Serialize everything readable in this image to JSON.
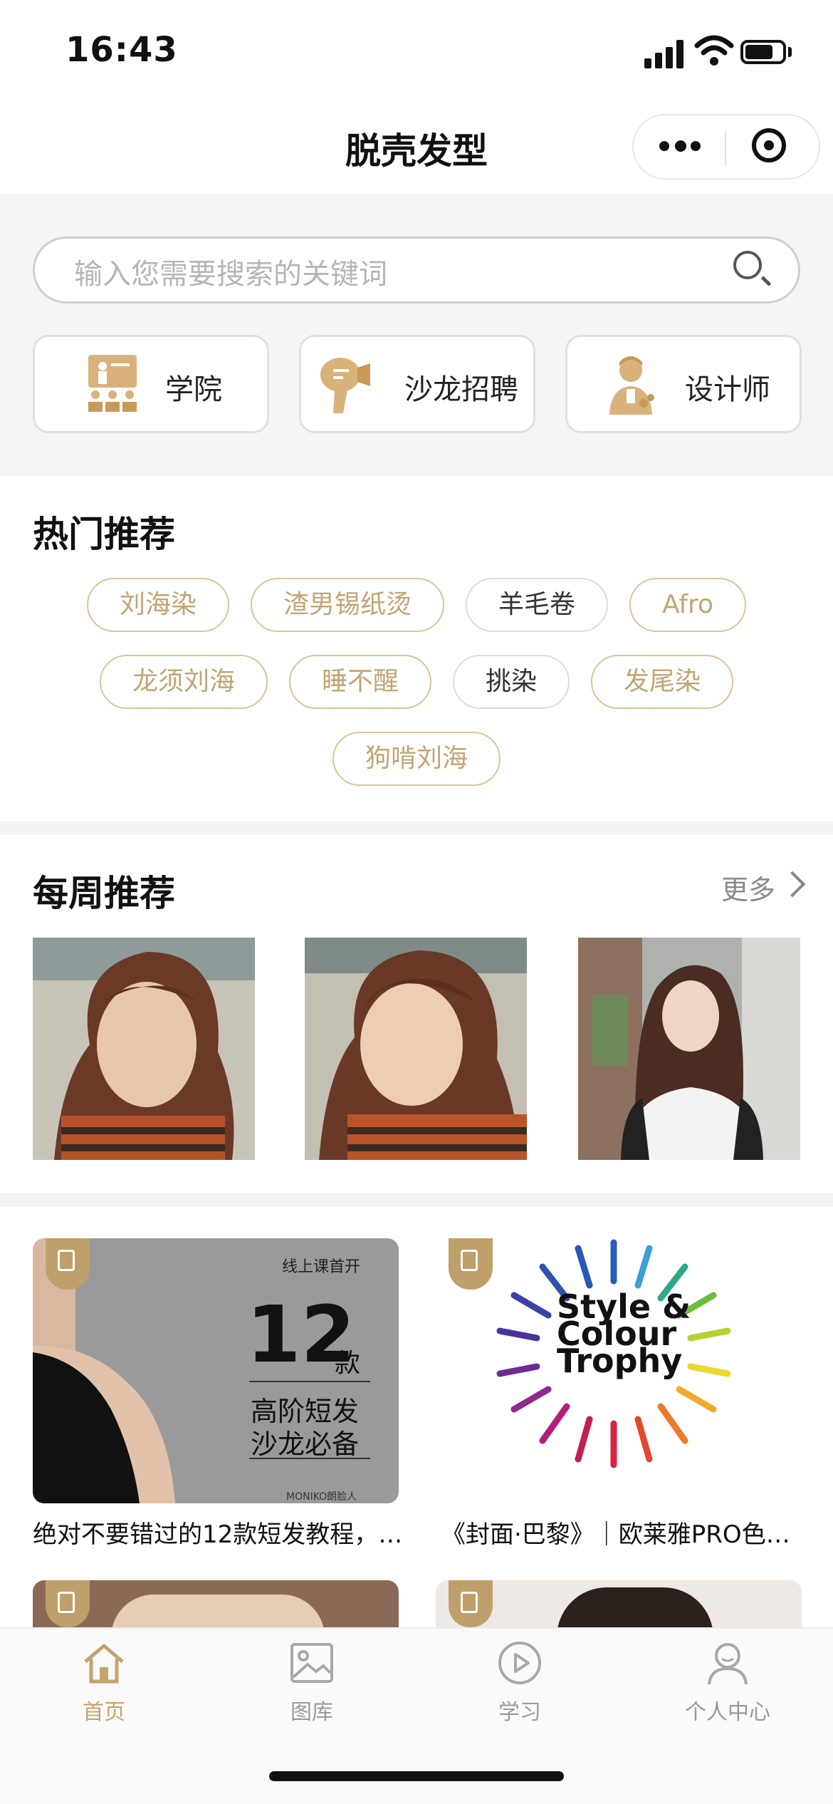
{
  "status_bar": {
    "time": "16:43"
  },
  "nav": {
    "title": "脱壳发型"
  },
  "search": {
    "placeholder": "输入您需要搜索的关键词"
  },
  "quick_links": [
    {
      "label": "学院",
      "icon": "academy-icon"
    },
    {
      "label": "沙龙招聘",
      "icon": "hair-dryer-icon"
    },
    {
      "label": "设计师",
      "icon": "designer-icon"
    }
  ],
  "hot": {
    "title": "热门推荐",
    "tags": [
      "刘海染",
      "渣男锡纸烫",
      "羊毛卷",
      "Afro",
      "龙须刘海",
      "睡不醒",
      "挑染",
      "发尾染",
      "狗啃刘海"
    ]
  },
  "weekly": {
    "title": "每周推荐",
    "more_label": "更多"
  },
  "feed": [
    {
      "title": "绝对不要错过的12款短发教程，…",
      "badge_icon": "document-icon",
      "cover": {
        "top_text": "线上课首开",
        "big_number": "12",
        "unit": "款",
        "line1": "高阶短发",
        "line2": "沙龙必备",
        "brand": "MONIKO朗脸人"
      }
    },
    {
      "title": "《封面·巴黎》｜欧莱雅PRO色…",
      "badge_icon": "document-icon",
      "cover": {
        "line1": "Style &",
        "line2": "Colour",
        "line3": "Trophy"
      }
    }
  ],
  "tabbar": {
    "items": [
      {
        "label": "首页",
        "icon": "home-icon",
        "active": true
      },
      {
        "label": "图库",
        "icon": "gallery-icon",
        "active": false
      },
      {
        "label": "学习",
        "icon": "play-icon",
        "active": false
      },
      {
        "label": "个人中心",
        "icon": "profile-icon",
        "active": false
      }
    ]
  },
  "colors": {
    "accent": "#bfa06a",
    "tag_border": "#d9c597",
    "background_section": "#f5f5f5"
  }
}
